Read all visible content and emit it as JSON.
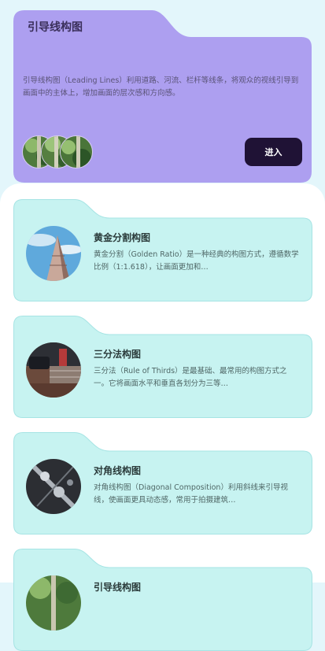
{
  "hero": {
    "title": "引导线构图",
    "description": "引导线构图（Leading Lines）利用道路、河流、栏杆等线条，将观众的视线引导到画面中的主体上，增加画面的层次感和方向感。",
    "enter_label": "进入"
  },
  "cards": [
    {
      "title": "黄金分割构图",
      "description": "黄金分割（Golden Ratio）是一种经典的构图方式，遵循数学比例（1:1.618），让画面更加和…"
    },
    {
      "title": "三分法构图",
      "description": "三分法（Rule of Thirds）是最基础、最常用的构图方式之一。它将画面水平和垂直各划分为三等…"
    },
    {
      "title": "对角线构图",
      "description": "对角线构图（Diagonal Composition）利用斜线来引导视线，使画面更具动态感，常用于拍摄建筑…"
    },
    {
      "title": "引导线构图",
      "description": ""
    }
  ],
  "colors": {
    "hero_bg": "#ad9ff0",
    "card_bg": "#c7f3f1",
    "card_border": "#a6e4e4",
    "button_bg": "#1f1235"
  }
}
